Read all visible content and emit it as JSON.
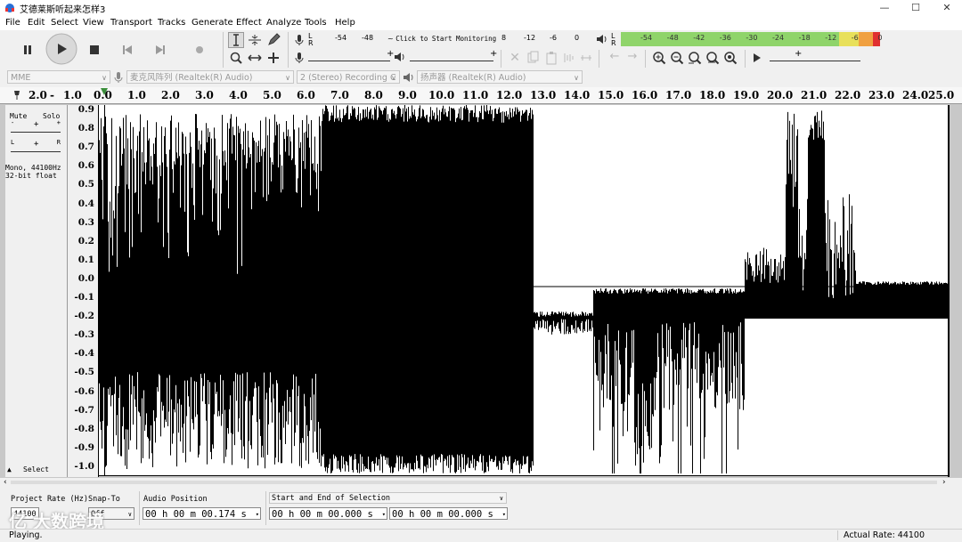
{
  "window": {
    "title": "艾德莱斯听起来怎样3",
    "minimize": "—",
    "maximize": "☐",
    "close": "✕"
  },
  "menu": [
    "File",
    "Edit",
    "Select",
    "View",
    "Transport",
    "Tracks",
    "Generate",
    "Effect",
    "Analyze",
    "Tools",
    "Help"
  ],
  "recording_meter": {
    "lr_l": "L",
    "lr_r": "R",
    "ticks": [
      "-54",
      "-48"
    ],
    "monitor_text": "Click to Start Monitoring",
    "ticks_right": [
      "8",
      "-12",
      "-6",
      "0"
    ]
  },
  "playback_meter": {
    "lr_l": "L",
    "lr_r": "R",
    "ticks": [
      "-54",
      "-48",
      "-42",
      "-36",
      "-30",
      "-24",
      "-18",
      "-12",
      "-6",
      "0"
    ],
    "colors": {
      "green": "#8fd46a",
      "yellow": "#e8e05a",
      "orange": "#f0a040",
      "red": "#e03030"
    }
  },
  "device": {
    "host": "MME",
    "recording_device": "麦克风阵列 (Realtek(R) Audio)",
    "channels": "2 (Stereo) Recording C",
    "playback_device": "扬声器 (Realtek(R) Audio)"
  },
  "ruler": {
    "labels": [
      "2.0",
      "-",
      "1.0",
      "0.0",
      "1.0",
      "2.0",
      "3.0",
      "4.0",
      "5.0",
      "6.0",
      "7.0",
      "8.0",
      "9.0",
      "10.0",
      "11.0",
      "12.0",
      "13.0",
      "14.0",
      "15.0",
      "16.0",
      "17.0",
      "18.0",
      "19.0",
      "20.0",
      "21.0",
      "22.0",
      "23.0",
      "24.0",
      "25.0"
    ]
  },
  "track": {
    "mute": "Mute",
    "solo": "Solo",
    "info_line1": "Mono, 44100Hz",
    "info_line2": "32-bit float",
    "select": "Select",
    "vruler": [
      "0.9",
      "0.8",
      "0.7",
      "0.6",
      "0.5",
      "0.4",
      "0.3",
      "0.2",
      "0.1",
      "0.0",
      "-0.1",
      "-0.2",
      "-0.3",
      "-0.4",
      "-0.5",
      "-0.6",
      "-0.7",
      "-0.8",
      "-0.9",
      "-1.0"
    ]
  },
  "selection_toolbar": {
    "project_rate_label": "Project Rate (Hz)",
    "project_rate_value": "44100",
    "snap_to_label": "Snap-To",
    "snap_to_value": "Off",
    "audio_position_label": "Audio Position",
    "audio_position_value": "00 h 00 m 00.174 s",
    "selection_label": "Start and End of Selection",
    "selection_start": "00 h 00 m 00.000 s",
    "selection_end": "00 h 00 m 00.000 s"
  },
  "status": {
    "state": "Playing.",
    "actual_rate": "Actual Rate: 44100"
  },
  "watermark": "亿 大数跨境"
}
